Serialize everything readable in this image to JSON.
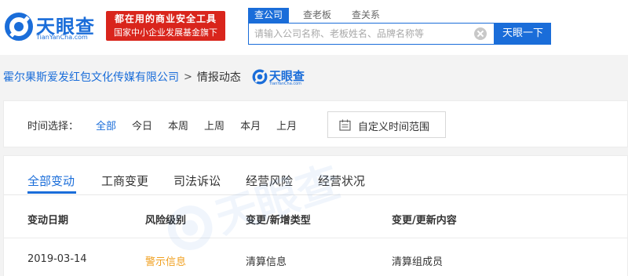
{
  "header": {
    "logo_text": "天眼查",
    "logo_sub": "TianYanCha.com",
    "promo_line1": "都在用的商业安全工具",
    "promo_line2": "国家中小企业发展基金旗下",
    "search_tabs": [
      {
        "label": "查公司",
        "active": true
      },
      {
        "label": "查老板",
        "active": false
      },
      {
        "label": "查关系",
        "active": false
      }
    ],
    "search_placeholder": "请输入公司名称、老板姓名、品牌名称等",
    "search_button": "天眼一下"
  },
  "breadcrumb": {
    "company": "霍尔果斯爱发红包文化传媒有限公司",
    "separator": ">",
    "current": "情报动态",
    "logo_text": "天眼查",
    "logo_sub": "TianYanCha.com"
  },
  "filter": {
    "label": "时间选择：",
    "options": [
      {
        "label": "全部",
        "active": true
      },
      {
        "label": "今日",
        "active": false
      },
      {
        "label": "本周",
        "active": false
      },
      {
        "label": "上周",
        "active": false
      },
      {
        "label": "本月",
        "active": false
      },
      {
        "label": "上月",
        "active": false
      }
    ],
    "custom_range": "自定义时间范围"
  },
  "tabs": [
    {
      "label": "全部变动",
      "active": true
    },
    {
      "label": "工商变更",
      "active": false
    },
    {
      "label": "司法诉讼",
      "active": false
    },
    {
      "label": "经营风险",
      "active": false
    },
    {
      "label": "经营状况",
      "active": false
    }
  ],
  "table": {
    "columns": [
      "变动日期",
      "风险级别",
      "变更/新增类型",
      "变更/更新内容"
    ],
    "rows": [
      [
        "2019-03-14",
        "警示信息",
        "清算信息",
        "清算组成员"
      ]
    ]
  },
  "watermark": "天眼查",
  "colors": {
    "brand_blue": "#1a6dd9",
    "promo_red": "#d9251c",
    "warning_orange": "#f0a020",
    "page_bg": "#f3f3f3"
  },
  "icons": {
    "logo": "tianyancha-logo-icon",
    "clear": "clear-icon",
    "calendar": "calendar-icon"
  }
}
